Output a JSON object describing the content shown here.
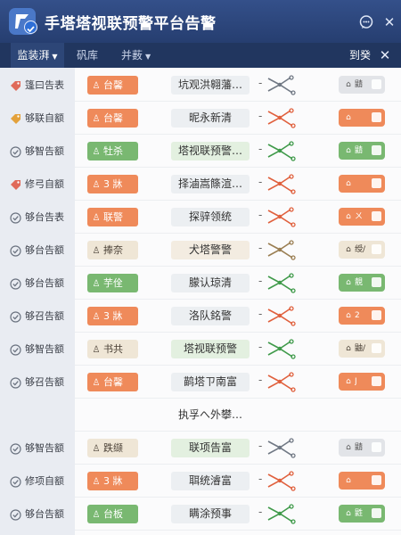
{
  "window": {
    "title": "手塔塔视联预警平台告警"
  },
  "titlebar": {
    "chat_icon": "chat-bubble-icon",
    "close_glyph": "✕"
  },
  "tabs": [
    {
      "label": "监装湃",
      "active": true,
      "has_caret": true
    },
    {
      "label": "矾库",
      "active": false,
      "has_caret": false
    },
    {
      "label": "并薮",
      "active": false,
      "has_caret": true
    }
  ],
  "tabbar_right": {
    "label": "到癸",
    "close_glyph": "✕"
  },
  "colors": {
    "orange": "#ef8a5a",
    "green": "#79b871",
    "beige": "#efe6d6",
    "title_bg": "#2b4275",
    "accent": "#2f6fd6"
  },
  "sidebar": {
    "items": [
      {
        "label": "篷曰告表",
        "icon": "tag-icon"
      },
      {
        "label": "够联自额",
        "icon": "tag-icon"
      },
      {
        "label": "够智告额",
        "icon": "check-circle-icon"
      },
      {
        "label": "修弓自额",
        "icon": "tag-icon"
      },
      {
        "label": "够台告表",
        "icon": "check-circle-icon"
      },
      {
        "label": "够台告额",
        "icon": "check-circle-icon"
      },
      {
        "label": "够台告额",
        "icon": "check-circle-icon"
      },
      {
        "label": "够召告额",
        "icon": "check-circle-icon"
      },
      {
        "label": "够智告额",
        "icon": "check-circle-icon"
      },
      {
        "label": "够召告额",
        "icon": "check-circle-icon"
      },
      {
        "label": "",
        "icon": ""
      },
      {
        "label": "够智告额",
        "icon": "check-circle-icon"
      },
      {
        "label": "修项自额",
        "icon": "check-circle-icon"
      },
      {
        "label": "够台告额",
        "icon": "check-circle-icon"
      }
    ]
  },
  "rows": [
    {
      "tag": "台馨",
      "tag_color": "orange",
      "tag_icon": "person-icon",
      "name": "坑观洪翱藩…",
      "name_style": "gray",
      "link": "gray",
      "status_color": "gray",
      "status_text": "鼱"
    },
    {
      "tag": "台馨",
      "tag_color": "orange",
      "tag_icon": "person-icon",
      "name": "昵永新清",
      "name_style": "gray",
      "link": "orange",
      "status_color": "orange",
      "status_text": ""
    },
    {
      "tag": "牡杀",
      "tag_color": "green",
      "tag_icon": "person-icon",
      "name": "塔视联预警…",
      "name_style": "green",
      "link": "green",
      "status_color": "green",
      "status_text": "鼱"
    },
    {
      "tag": "3 牀",
      "tag_color": "orange",
      "tag_icon": "person-icon",
      "name": "择滷嵩篨渲…",
      "name_style": "gray",
      "link": "orange",
      "status_color": "orange",
      "status_text": ""
    },
    {
      "tag": "联警",
      "tag_color": "orange",
      "tag_icon": "person-icon",
      "name": "探骍领统",
      "name_style": "gray",
      "link": "orange",
      "status_color": "orange",
      "status_text": "ㄨ"
    },
    {
      "tag": "捧奈",
      "tag_color": "beige",
      "tag_icon": "person-icon",
      "name": "犬塔警警",
      "name_style": "beige",
      "link": "beige",
      "status_color": "beige",
      "status_text": "绶/"
    },
    {
      "tag": "芋佺",
      "tag_color": "green",
      "tag_icon": "person-icon",
      "name": "朦认琼清",
      "name_style": "gray",
      "link": "green",
      "status_color": "green",
      "status_text": "靚"
    },
    {
      "tag": "3 牀",
      "tag_color": "orange",
      "tag_icon": "person-icon",
      "name": "洛队銘警",
      "name_style": "gray",
      "link": "orange",
      "status_color": "orange",
      "status_text": "2"
    },
    {
      "tag": "书共",
      "tag_color": "beige",
      "tag_icon": "person-icon",
      "name": "塔视联预警",
      "name_style": "green",
      "link": "green",
      "status_color": "beige",
      "status_text": "鼬/"
    },
    {
      "tag": "台馨",
      "tag_color": "orange",
      "tag_icon": "person-icon",
      "name": "鹋塔ㄗ南富",
      "name_style": "gray",
      "link": "orange",
      "status_color": "orange",
      "status_text": "J"
    },
    {
      "tag": "",
      "tag_color": "",
      "tag_icon": "",
      "name": "执孚へ外攀…",
      "name_style": "none",
      "link": "",
      "status_color": "",
      "status_text": ""
    },
    {
      "tag": "跌缬",
      "tag_color": "beige",
      "tag_icon": "person-icon",
      "name": "联项告富",
      "name_style": "green",
      "link": "gray",
      "status_color": "gray",
      "status_text": "鼱"
    },
    {
      "tag": "3 牀",
      "tag_color": "orange",
      "tag_icon": "person-icon",
      "name": "聑统濬富",
      "name_style": "gray",
      "link": "orange",
      "status_color": "orange",
      "status_text": ""
    },
    {
      "tag": "台板",
      "tag_color": "green",
      "tag_icon": "person-icon",
      "name": "瞒涂预事",
      "name_style": "gray",
      "link": "green",
      "status_color": "green",
      "status_text": "鼪"
    }
  ]
}
